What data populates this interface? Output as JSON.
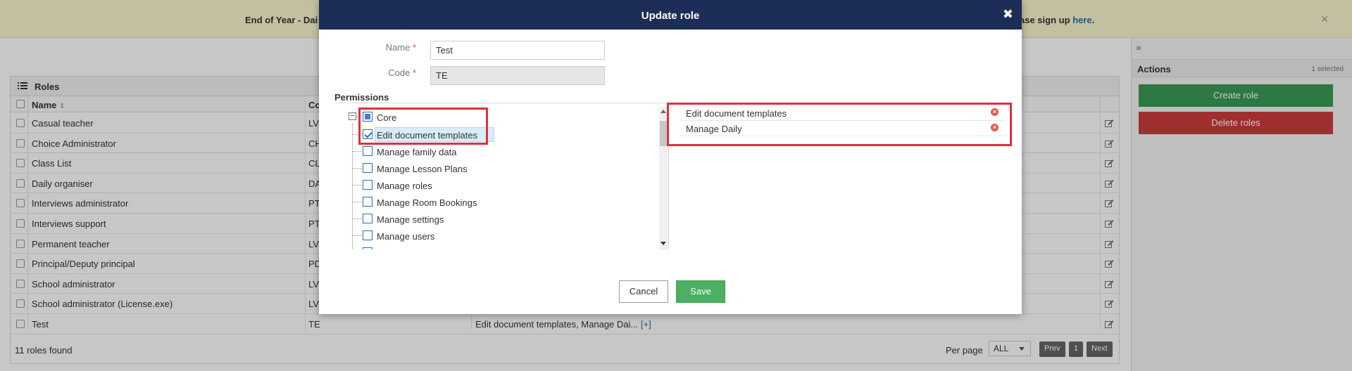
{
  "banner": {
    "left_text": "End of Year - Dai",
    "right_text": "ase sign up ",
    "link": "here",
    "link_suffix": ".",
    "close": "×"
  },
  "roles": {
    "title": "Roles",
    "col_name": "Name",
    "col_code": "Co",
    "rows": [
      {
        "name": "Casual teacher",
        "code": "LV",
        "perms": ""
      },
      {
        "name": "Choice Administrator",
        "code": "CH",
        "perms": ""
      },
      {
        "name": "Class List",
        "code": "CL",
        "perms": ""
      },
      {
        "name": "Daily organiser",
        "code": "DA",
        "perms": ""
      },
      {
        "name": "Interviews administrator",
        "code": "PT",
        "perms": ""
      },
      {
        "name": "Interviews support",
        "code": "PT",
        "perms": ""
      },
      {
        "name": "Permanent teacher",
        "code": "LV",
        "perms": ""
      },
      {
        "name": "Principal/Deputy principal",
        "code": "PD",
        "perms": ""
      },
      {
        "name": "School administrator",
        "code": "LV",
        "perms": ""
      },
      {
        "name": "School administrator (License.exe)",
        "code": "LV",
        "perms": ""
      },
      {
        "name": "Test",
        "code": "TE",
        "perms": "Edit document templates, Manage Dai...",
        "more": "[+]"
      }
    ],
    "count": "11 roles found",
    "per_page_label": "Per page",
    "per_page_value": "ALL",
    "prev": "Prev",
    "page": "1",
    "next": "Next"
  },
  "sidebar": {
    "expand": "»",
    "actions_title": "Actions",
    "selected": "1 selected",
    "create_label": "Create role",
    "delete_label": "Delete roles",
    "create_color": "#3a9a57",
    "delete_color": "#cc3d3d"
  },
  "modal": {
    "title": "Update role",
    "close": "✖",
    "name_label": "Name",
    "name_value": "Test",
    "code_label": "Code",
    "code_value": "TE",
    "required": "*",
    "permissions_title": "Permissions",
    "tree": {
      "root": "Core",
      "root_expander": "−",
      "items": [
        {
          "label": "Edit document templates",
          "checked": true
        },
        {
          "label": "Manage family data",
          "checked": false
        },
        {
          "label": "Manage Lesson Plans",
          "checked": false
        },
        {
          "label": "Manage roles",
          "checked": false
        },
        {
          "label": "Manage Room Bookings",
          "checked": false
        },
        {
          "label": "Manage settings",
          "checked": false
        },
        {
          "label": "Manage users",
          "checked": false
        }
      ]
    },
    "selected_perms": [
      "Edit document templates",
      "Manage Daily"
    ],
    "remove_glyph": "×",
    "cancel_label": "Cancel",
    "save_label": "Save"
  }
}
